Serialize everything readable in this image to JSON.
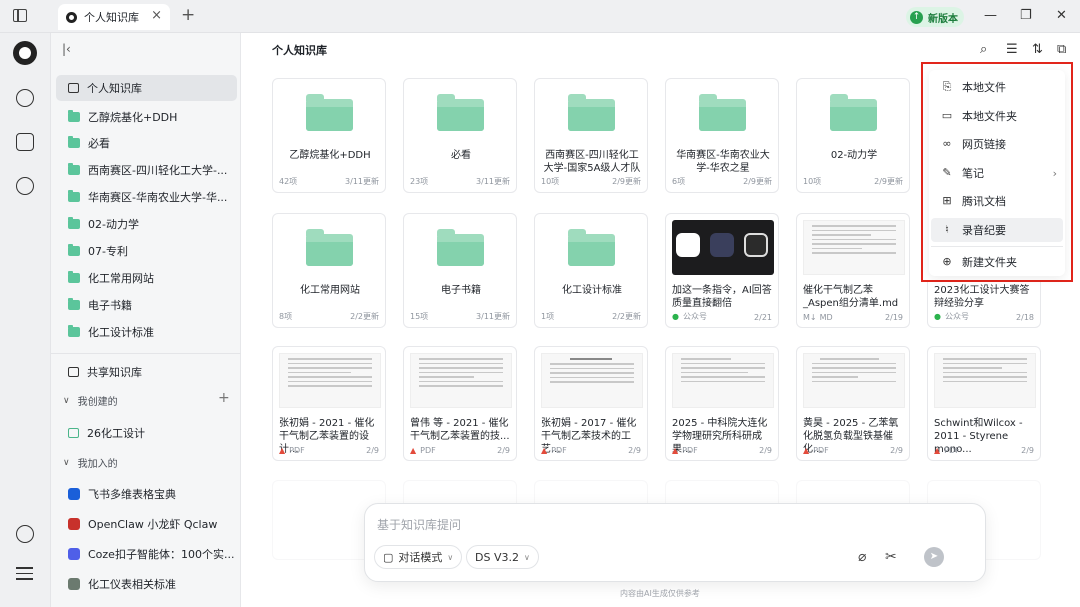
{
  "titlebar": {
    "tab_label": "个人知识库",
    "tab_close": "×",
    "tab_add": "+",
    "new_version": "新版本",
    "win_min": "—",
    "win_max": "❐",
    "win_close": "✕"
  },
  "sidebar": {
    "collapse": "|‹",
    "personal_kb": "个人知识库",
    "folders": [
      "乙醇烷基化+DDH",
      "必看",
      "西南赛区-四川轻化工大学-...",
      "华南赛区-华南农业大学-华...",
      "02-动力学",
      "07-专利",
      "化工常用网站",
      "电子书籍",
      "化工设计标准"
    ],
    "shared_kb": "共享知识库",
    "created_by_me": "我创建的",
    "created_items": [
      "26化工设计"
    ],
    "joined": "我加入的",
    "joined_items": [
      "飞书多维表格宝典",
      "OpenClaw 小龙虾 Qclaw",
      "Coze扣子智能体：100个实...",
      "化工仪表相关标准"
    ]
  },
  "main": {
    "title": "个人知识库",
    "cards_row1": [
      {
        "title": "乙醇烷基化+DDH",
        "meta": "42项",
        "date": "3/11更新"
      },
      {
        "title": "必看",
        "meta": "23项",
        "date": "3/11更新"
      },
      {
        "title": "西南赛区-四川轻化工大学-国家5A级人才队",
        "meta": "10项",
        "date": "2/9更新"
      },
      {
        "title": "华南赛区-华南农业大学-华农之星",
        "meta": "6项",
        "date": "2/9更新"
      },
      {
        "title": "02-动力学",
        "meta": "10项",
        "date": "2/9更新"
      }
    ],
    "cards_row2": [
      {
        "title": "化工常用网站",
        "meta": "8项",
        "date": "2/2更新"
      },
      {
        "title": "电子书籍",
        "meta": "15项",
        "date": "3/11更新"
      },
      {
        "title": "化工设计标准",
        "meta": "1项",
        "date": "2/2更新"
      },
      {
        "title": "加这一条指令，AI回答质量直接翻倍",
        "meta": "公众号",
        "date": "2/21"
      },
      {
        "title": "催化干气制乙苯_Aspen组分清单.md",
        "meta": "MD",
        "date": "2/19"
      },
      {
        "title": "2023化工设计大赛答辩经验分享",
        "meta": "公众号",
        "date": "2/18"
      }
    ],
    "cards_row3": [
      {
        "title": "张初娟 - 2021 - 催化干气制乙苯装置的设计...",
        "meta": "PDF",
        "date": "2/9"
      },
      {
        "title": "曾伟 等 - 2021 - 催化干气制乙苯装置的技...",
        "meta": "PDF",
        "date": "2/9"
      },
      {
        "title": "张初娟 - 2017 - 催化干气制乙苯技术的工艺...",
        "meta": "PDF",
        "date": "2/9"
      },
      {
        "title": "2025 - 中科院大连化学物理研究所科研成果...",
        "meta": "PDF",
        "date": "2/9"
      },
      {
        "title": "黄昊 - 2025 - 乙苯氧化脱氢负载型铁基催化...",
        "meta": "PDF",
        "date": "2/9"
      },
      {
        "title": "Schwint和Wilcox - 2011 - Styrene mono...",
        "meta": "PDF",
        "date": "2/9"
      }
    ]
  },
  "chat": {
    "placeholder": "基于知识库提问",
    "mode": "对话模式",
    "model": "DS V3.2",
    "footnote": "内容由AI生成仅供参考"
  },
  "menu": {
    "items": [
      "本地文件",
      "本地文件夹",
      "网页链接",
      "笔记",
      "腾讯文档",
      "录音纪要",
      "新建文件夹"
    ]
  },
  "colors": {
    "accent_green": "#27a04f",
    "folder_green": "#9fdcbe",
    "highlight_red": "#e1251b"
  }
}
